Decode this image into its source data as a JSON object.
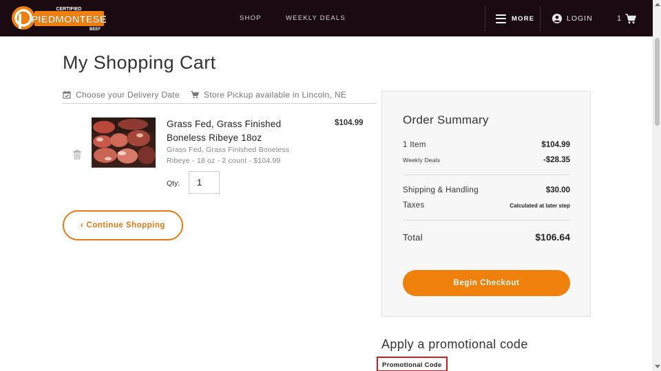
{
  "header": {
    "logo": {
      "top_text": "CERTIFIED",
      "main_text": "PIEDMONTESE",
      "bottom_text": "BEEF"
    },
    "nav": [
      {
        "label": "SHOP"
      },
      {
        "label": "WEEKLY DEALS"
      }
    ],
    "more_label": "MORE",
    "login_label": "LOGIN",
    "cart_count": "1"
  },
  "page": {
    "title": "My Shopping Cart"
  },
  "delivery": {
    "choose_date": "Choose your Delivery Date",
    "pickup": "Store Pickup available in Lincoln, NE"
  },
  "cart": {
    "items": [
      {
        "name": "Grass Fed, Grass Finished Boneless Ribeye 18oz",
        "description": "Grass Fed, Grass Finished Boneless Ribeye - 18 oz - 2 count - $104.99",
        "price": "$104.99",
        "qty_label": "Qty:",
        "qty": "1"
      }
    ],
    "continue_label": "Continue Shopping",
    "continue_chevron": "‹"
  },
  "summary": {
    "title": "Order Summary",
    "rows": [
      {
        "label": "1 Item",
        "value": "$104.99"
      },
      {
        "label": "Weekly Deals",
        "value": "-$28.35"
      },
      {
        "label": "Shipping & Handling",
        "value": "$30.00"
      },
      {
        "label": "Taxes",
        "value": "Calculated at later step"
      },
      {
        "label": "Total",
        "value": "$106.64"
      }
    ],
    "checkout_label": "Begin Checkout"
  },
  "promo": {
    "heading": "Apply a promotional code",
    "field_label": "Promotional Code"
  },
  "colors": {
    "header_bg": "#1a0b12",
    "accent_orange": "#ee800b",
    "highlight_red": "#d11a1a"
  },
  "icons": [
    "calendar-check-icon",
    "store-cart-icon",
    "trash-icon",
    "hamburger-icon",
    "user-circle-icon",
    "shopping-cart-icon"
  ]
}
